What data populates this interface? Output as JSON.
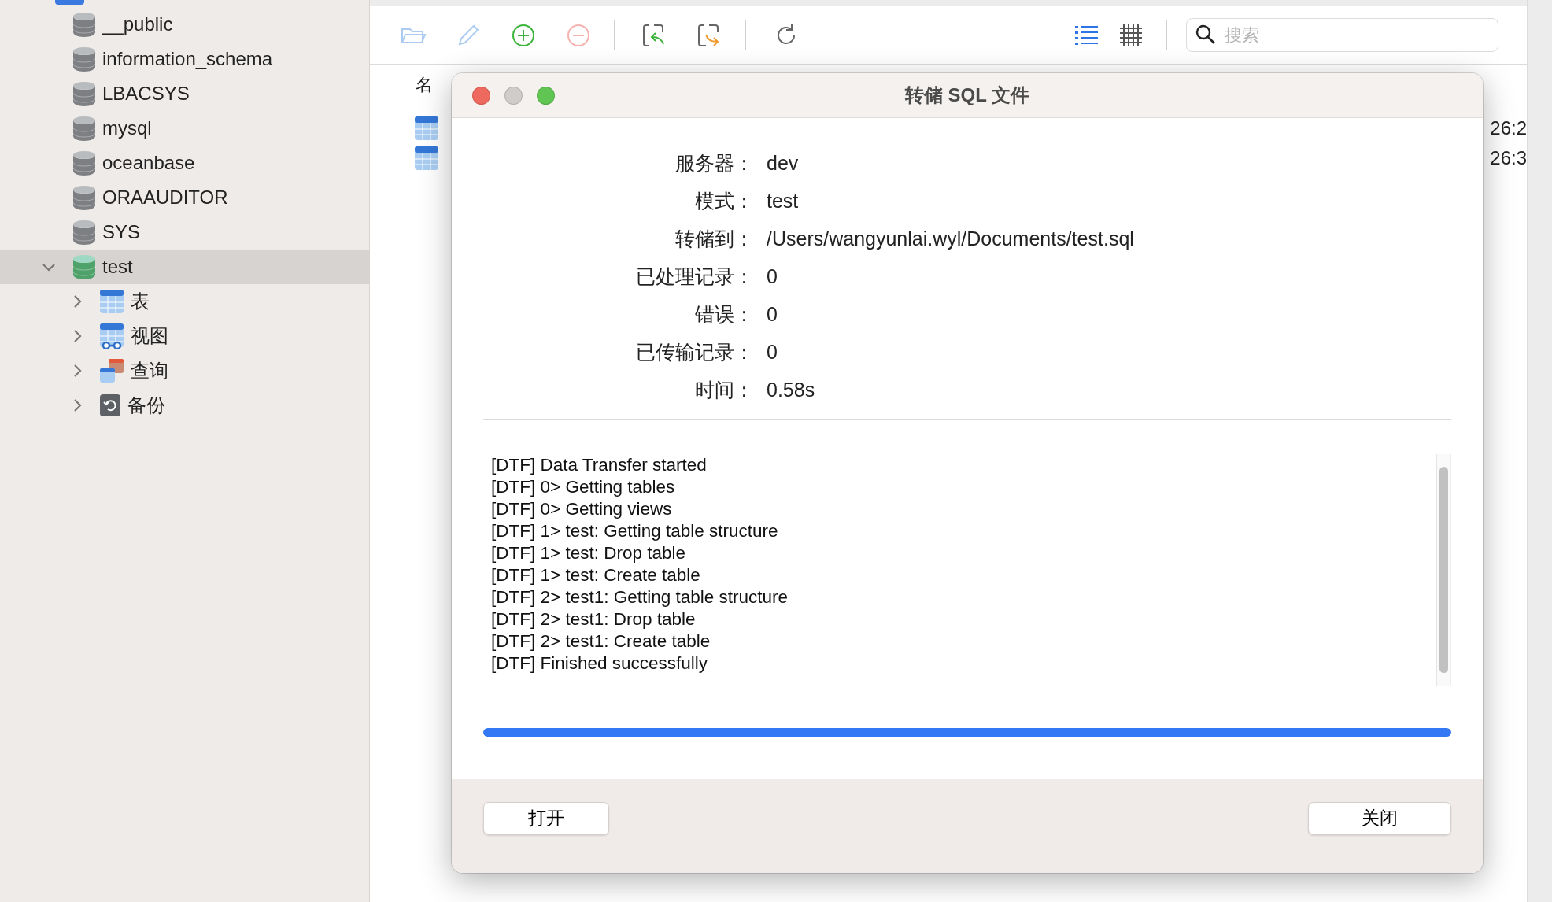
{
  "sidebar": {
    "items": [
      {
        "label": "__public",
        "open": false,
        "selected": false
      },
      {
        "label": "information_schema",
        "open": false,
        "selected": false
      },
      {
        "label": "LBACSYS",
        "open": false,
        "selected": false
      },
      {
        "label": "mysql",
        "open": false,
        "selected": false
      },
      {
        "label": "oceanbase",
        "open": false,
        "selected": false
      },
      {
        "label": "ORAAUDITOR",
        "open": false,
        "selected": false
      },
      {
        "label": "SYS",
        "open": false,
        "selected": false
      },
      {
        "label": "test",
        "open": true,
        "selected": true,
        "expanded": true,
        "children": [
          {
            "label": "表",
            "kind": "table",
            "expanded": false
          },
          {
            "label": "视图",
            "kind": "view",
            "expanded": false
          },
          {
            "label": "查询",
            "kind": "query",
            "expanded": false
          },
          {
            "label": "备份",
            "kind": "backup",
            "expanded": false
          }
        ]
      }
    ]
  },
  "toolbar": {
    "buttons": [
      {
        "kind": "open",
        "disabled": true
      },
      {
        "kind": "edit",
        "disabled": true
      },
      {
        "kind": "add",
        "disabled": false
      },
      {
        "kind": "remove",
        "disabled": true
      },
      {
        "kind": "separator"
      },
      {
        "kind": "import",
        "disabled": false
      },
      {
        "kind": "export",
        "disabled": false
      },
      {
        "kind": "separator"
      },
      {
        "kind": "refresh",
        "disabled": false
      }
    ],
    "views": [
      {
        "kind": "list",
        "selected": true
      },
      {
        "kind": "grid",
        "selected": false
      }
    ],
    "search": {
      "placeholder": "搜索"
    }
  },
  "table": {
    "columns": [
      "名"
    ],
    "rows": [
      {
        "kind": "table",
        "column_2": "26:2"
      },
      {
        "kind": "table",
        "column_2": "26:3"
      }
    ]
  },
  "dialog": {
    "title": "转储 SQL 文件",
    "fields": [
      {
        "label": "服务器：",
        "value": "dev"
      },
      {
        "label": "模式：",
        "value": "test"
      },
      {
        "label": "转储到：",
        "value": "/Users/wangyunlai.wyl/Documents/test.sql"
      },
      {
        "label": "已处理记录：",
        "value": "0"
      },
      {
        "label": "错误：",
        "value": "0"
      },
      {
        "label": "已传输记录：",
        "value": "0"
      },
      {
        "label": "时间：",
        "value": "0.58s"
      }
    ],
    "log": [
      "[DTF] Data Transfer started",
      "[DTF] 0> Getting tables",
      "[DTF] 0> Getting views",
      "[DTF] 1> test: Getting table structure",
      "[DTF] 1> test: Drop table",
      "[DTF] 1> test: Create table",
      "[DTF] 2> test1: Getting table structure",
      "[DTF] 2> test1: Drop table",
      "[DTF] 2> test1: Create table",
      "[DTF] Finished successfully"
    ],
    "progress": {
      "level": 1
    },
    "buttons": [
      "打开",
      "关闭"
    ]
  }
}
